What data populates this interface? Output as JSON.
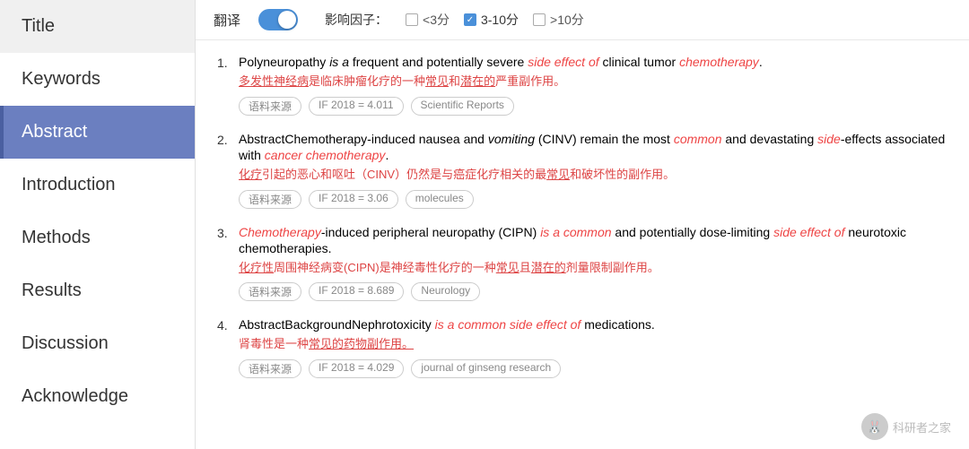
{
  "sidebar": {
    "items": [
      {
        "id": "title",
        "label": "Title",
        "active": false
      },
      {
        "id": "keywords",
        "label": "Keywords",
        "active": false
      },
      {
        "id": "abstract",
        "label": "Abstract",
        "active": true
      },
      {
        "id": "introduction",
        "label": "Introduction",
        "active": false
      },
      {
        "id": "methods",
        "label": "Methods",
        "active": false
      },
      {
        "id": "results",
        "label": "Results",
        "active": false
      },
      {
        "id": "discussion",
        "label": "Discussion",
        "active": false
      },
      {
        "id": "acknowledge",
        "label": "Acknowledge",
        "active": false
      }
    ]
  },
  "toolbar": {
    "translate_label": "翻译",
    "toggle_on": true,
    "impact_label": "影响因子：",
    "filters": [
      {
        "id": "lt3",
        "label": "<3分",
        "checked": false
      },
      {
        "id": "3to10",
        "label": "3-10分",
        "checked": true
      },
      {
        "id": "gt10",
        "label": ">10分",
        "checked": false
      }
    ]
  },
  "entries": [
    {
      "num": "1.",
      "text_parts": [
        {
          "text": "Polyneuropathy ",
          "style": "normal"
        },
        {
          "text": "is a",
          "style": "italic"
        },
        {
          "text": " frequent and potentially severe ",
          "style": "normal"
        },
        {
          "text": "side effect of",
          "style": "red-italic"
        },
        {
          "text": " clinical tumor ",
          "style": "normal"
        },
        {
          "text": "chemotherapy",
          "style": "red-italic"
        },
        {
          "text": ".",
          "style": "normal"
        }
      ],
      "cn_parts": [
        {
          "text": "多发性神经病",
          "style": "underline"
        },
        {
          "text": "是临床肿瘤化疗的一种",
          "style": "normal"
        },
        {
          "text": "常见",
          "style": "underline"
        },
        {
          "text": "和",
          "style": "normal"
        },
        {
          "text": "潜在的",
          "style": "underline"
        },
        {
          "text": "严重副作用。",
          "style": "normal"
        }
      ],
      "tags": [
        {
          "label": "语料来源",
          "type": "source"
        },
        {
          "label": "IF 2018 = 4.011",
          "type": "if"
        },
        {
          "label": "Scientific Reports",
          "type": "journal"
        }
      ]
    },
    {
      "num": "2.",
      "text_parts": [
        {
          "text": "AbstractChemotherapy-induced nausea and ",
          "style": "normal"
        },
        {
          "text": "vomiting",
          "style": "italic"
        },
        {
          "text": " (CINV) remain the most ",
          "style": "normal"
        },
        {
          "text": "common",
          "style": "red-italic"
        },
        {
          "text": " and devastating ",
          "style": "normal"
        },
        {
          "text": "side",
          "style": "red-italic"
        },
        {
          "text": "-effects associated with ",
          "style": "normal"
        },
        {
          "text": "cancer chemotherapy",
          "style": "red-italic"
        },
        {
          "text": ".",
          "style": "normal"
        }
      ],
      "cn_parts": [
        {
          "text": "化疗",
          "style": "underline"
        },
        {
          "text": "引起的恶心和呕吐（CINV）仍然是与癌症化疗相关的最",
          "style": "normal"
        },
        {
          "text": "常见",
          "style": "underline"
        },
        {
          "text": "和破坏性的副作用。",
          "style": "normal"
        }
      ],
      "tags": [
        {
          "label": "语料来源",
          "type": "source"
        },
        {
          "label": "IF 2018 = 3.06",
          "type": "if"
        },
        {
          "label": "molecules",
          "type": "journal"
        }
      ]
    },
    {
      "num": "3.",
      "text_parts": [
        {
          "text": "Chemotherapy",
          "style": "red-italic"
        },
        {
          "text": "-induced peripheral neuropathy (CIPN) ",
          "style": "normal"
        },
        {
          "text": "is a common",
          "style": "red-italic"
        },
        {
          "text": " and potentially dose-limiting ",
          "style": "normal"
        },
        {
          "text": "side effect of",
          "style": "red-italic"
        },
        {
          "text": " neurotoxic chemotherapies.",
          "style": "normal"
        }
      ],
      "cn_parts": [
        {
          "text": "化疗性",
          "style": "underline"
        },
        {
          "text": "周围神经病变(CIPN)是神经毒性化疗的一种",
          "style": "normal"
        },
        {
          "text": "常见",
          "style": "underline"
        },
        {
          "text": "且",
          "style": "normal"
        },
        {
          "text": "潜在的",
          "style": "underline"
        },
        {
          "text": "剂量限制副作用。",
          "style": "normal"
        }
      ],
      "tags": [
        {
          "label": "语料来源",
          "type": "source"
        },
        {
          "label": "IF 2018 = 8.689",
          "type": "if"
        },
        {
          "label": "Neurology",
          "type": "journal"
        }
      ]
    },
    {
      "num": "4.",
      "text_parts": [
        {
          "text": "AbstractBackgroundNephrotoxicity ",
          "style": "normal"
        },
        {
          "text": "is a common side effect of",
          "style": "red-italic"
        },
        {
          "text": " medications.",
          "style": "normal"
        }
      ],
      "cn_parts": [
        {
          "text": "肾毒性是一种",
          "style": "normal"
        },
        {
          "text": "常见的",
          "style": "underline"
        },
        {
          "text": "药物副作用。",
          "style": "underline"
        }
      ],
      "tags": [
        {
          "label": "语料来源",
          "type": "source"
        },
        {
          "label": "IF 2018 = 4.029",
          "type": "if"
        },
        {
          "label": "journal of ginseng research",
          "type": "journal"
        }
      ]
    }
  ],
  "watermark": {
    "text": "科研者之家"
  }
}
